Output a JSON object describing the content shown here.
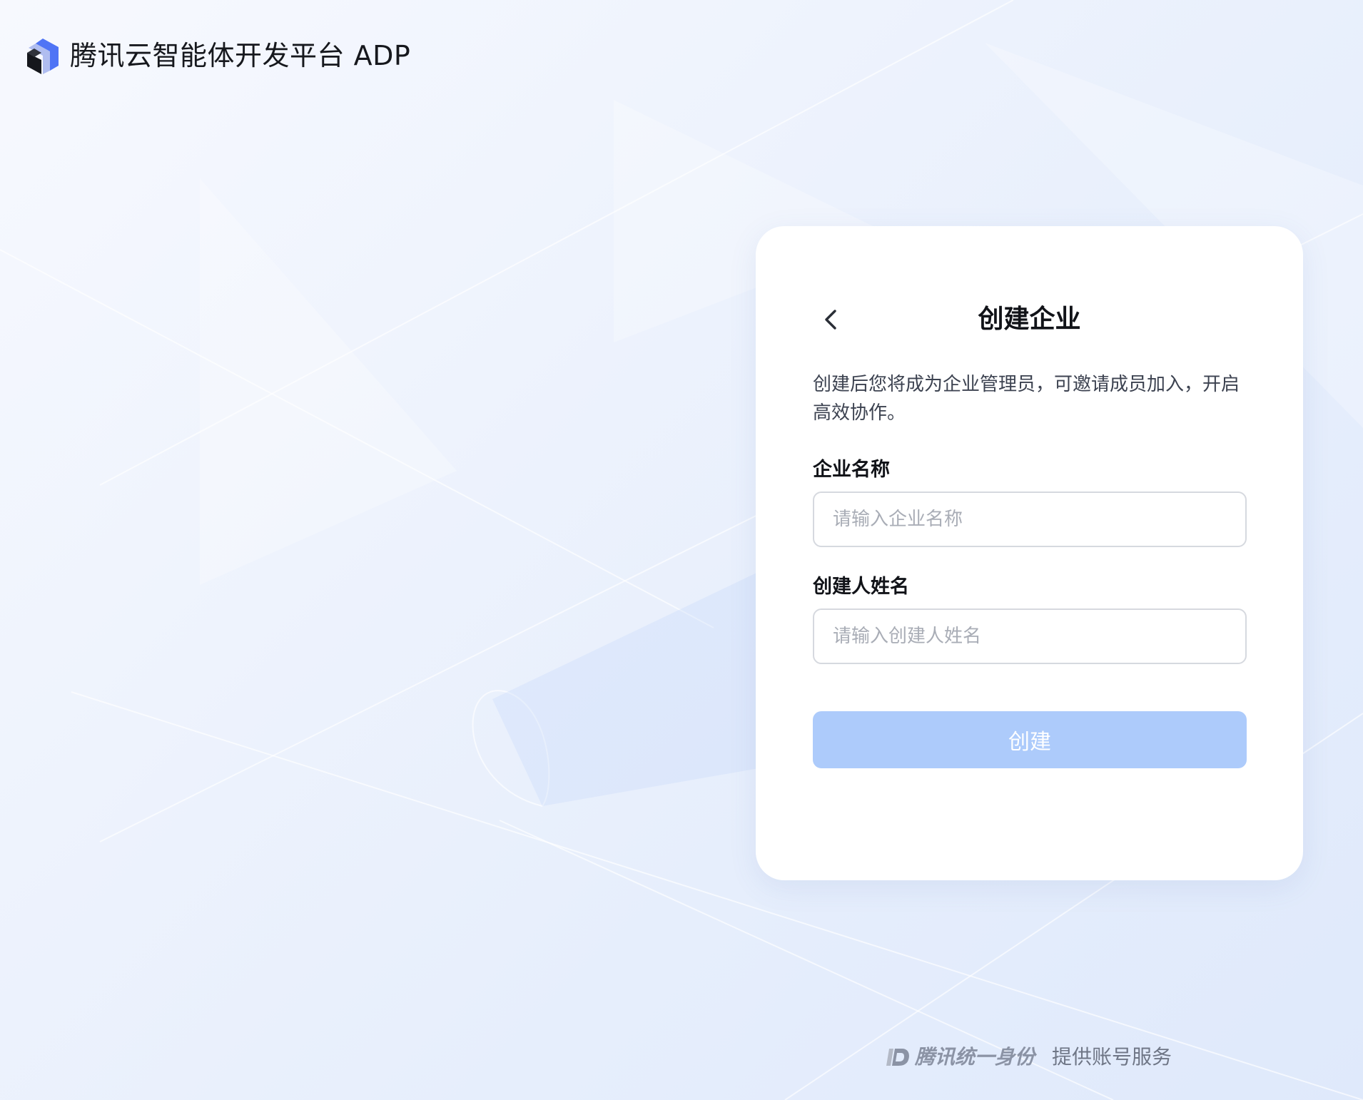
{
  "header": {
    "brand_name": "腾讯云智能体开发平台 ADP"
  },
  "card": {
    "title": "创建企业",
    "description": "创建后您将成为企业管理员，可邀请成员加入，开启高效协作。",
    "fields": [
      {
        "label": "企业名称",
        "placeholder": "请输入企业名称",
        "value": ""
      },
      {
        "label": "创建人姓名",
        "placeholder": "请输入创建人姓名",
        "value": ""
      }
    ],
    "submit_label": "创建",
    "submit_enabled": false
  },
  "footer": {
    "brand": "腾讯统一身份",
    "service": "提供账号服务"
  },
  "icons": {
    "brand_logo": "tencent-cloud-cube-icon",
    "back": "chevron-left-icon",
    "footer_logo": "tencent-id-icon"
  },
  "colors": {
    "accent": "#4a7cf6",
    "button_disabled": "#adcbfb"
  }
}
